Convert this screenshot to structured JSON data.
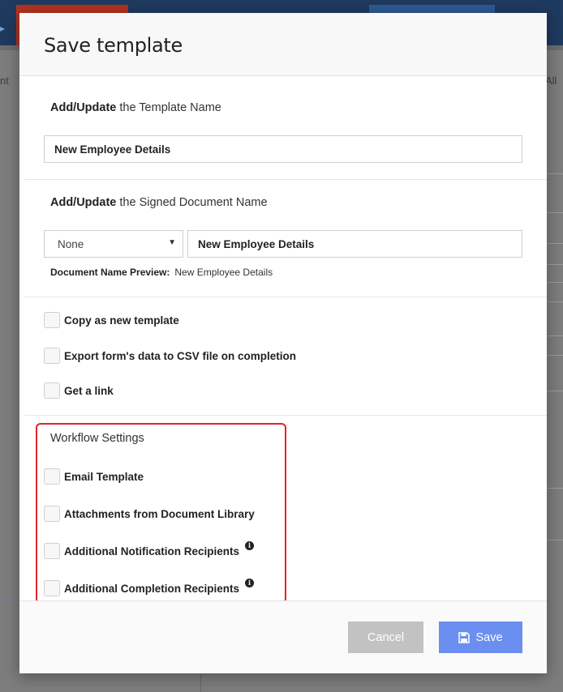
{
  "background": {
    "left_fragment": "nt",
    "right_fragment": "All"
  },
  "dialog": {
    "title": "Save template",
    "template_name": {
      "label_bold": "Add/Update",
      "label_rest": " the Template Name",
      "value": "New Employee Details"
    },
    "document_name": {
      "label_bold": "Add/Update",
      "label_rest": " the Signed Document Name",
      "prefix_select": "None",
      "value": "New Employee Details",
      "preview_label": "Document Name Preview:",
      "preview_value": "New Employee Details"
    },
    "options": [
      {
        "label": "Copy as new template",
        "checked": false
      },
      {
        "label": "Export form's data to CSV file on completion",
        "checked": false
      },
      {
        "label": "Get a link",
        "checked": false
      }
    ],
    "workflow": {
      "title": "Workflow Settings",
      "items": [
        {
          "label": "Email Template",
          "checked": false,
          "info": false
        },
        {
          "label": "Attachments from Document Library",
          "checked": false,
          "info": false
        },
        {
          "label": "Additional Notification Recipients",
          "checked": false,
          "info": true
        },
        {
          "label": "Additional Completion Recipients",
          "checked": false,
          "info": true
        }
      ]
    },
    "buttons": {
      "cancel": "Cancel",
      "save": "Save"
    },
    "colors": {
      "save_button": "#6b8ff0",
      "cancel_button": "#c2c2c2",
      "highlight_border": "#e0242c"
    }
  }
}
